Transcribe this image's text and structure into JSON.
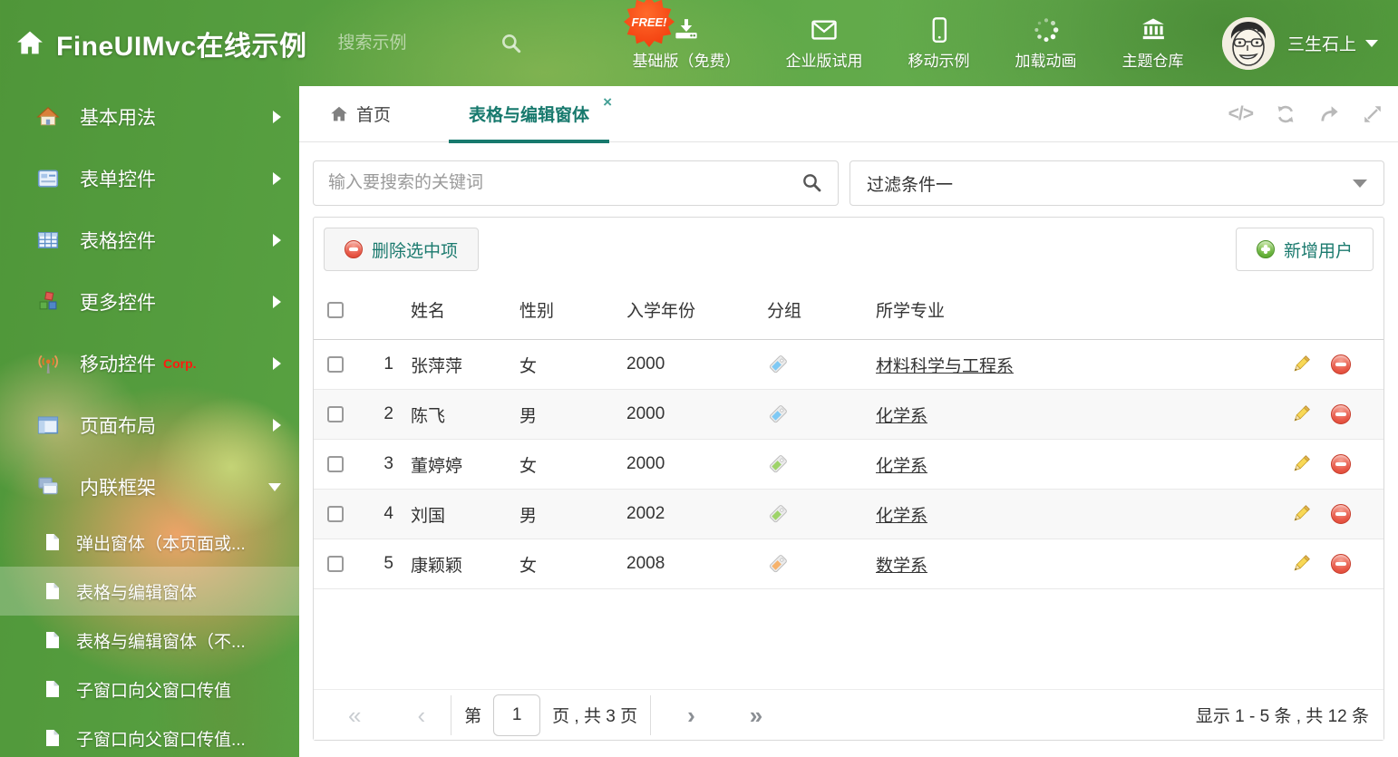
{
  "colors": {
    "accent_teal": "#17796d",
    "header_green": "#58a33e",
    "free_badge_orange": "#ff5126",
    "delete_red": "#e85948",
    "add_green": "#68b33b"
  },
  "header": {
    "title": "FineUIMvc在线示例",
    "search_placeholder": "搜索示例",
    "free_badge": "FREE!",
    "nav": [
      {
        "label": "基础版（免费）"
      },
      {
        "label": "企业版试用"
      },
      {
        "label": "移动示例"
      },
      {
        "label": "加载动画"
      },
      {
        "label": "主题仓库"
      }
    ],
    "user_name": "三生石上"
  },
  "sidebar": {
    "items": [
      {
        "label": "基本用法"
      },
      {
        "label": "表单控件"
      },
      {
        "label": "表格控件"
      },
      {
        "label": "更多控件"
      },
      {
        "label": "移动控件",
        "badge": "Corp."
      },
      {
        "label": "页面布局"
      },
      {
        "label": "内联框架"
      }
    ],
    "subitems": [
      {
        "label": "弹出窗体（本页面或..."
      },
      {
        "label": "表格与编辑窗体"
      },
      {
        "label": "表格与编辑窗体（不..."
      },
      {
        "label": "子窗口向父窗口传值"
      },
      {
        "label": "子窗口向父窗口传值..."
      }
    ]
  },
  "tabs": {
    "home_label": "首页",
    "active_label": "表格与编辑窗体"
  },
  "filter": {
    "search_placeholder": "输入要搜索的关键词",
    "dropdown_value": "过滤条件一"
  },
  "toolbar": {
    "delete_label": "删除选中项",
    "add_label": "新增用户"
  },
  "table": {
    "columns": {
      "name": "姓名",
      "gender": "性别",
      "year": "入学年份",
      "group": "分组",
      "major": "所学专业"
    },
    "rows": [
      {
        "index": "1",
        "name": "张萍萍",
        "gender": "女",
        "year": "2000",
        "tag_color": "#7fc9f4",
        "major": "材料科学与工程系"
      },
      {
        "index": "2",
        "name": "陈飞",
        "gender": "男",
        "year": "2000",
        "tag_color": "#7fc9f4",
        "major": "化学系"
      },
      {
        "index": "3",
        "name": "董婷婷",
        "gender": "女",
        "year": "2000",
        "tag_color": "#9ed36a",
        "major": "化学系"
      },
      {
        "index": "4",
        "name": "刘国",
        "gender": "男",
        "year": "2002",
        "tag_color": "#9ed36a",
        "major": "化学系"
      },
      {
        "index": "5",
        "name": "康颖颖",
        "gender": "女",
        "year": "2008",
        "tag_color": "#f6b26b",
        "major": "数学系"
      }
    ]
  },
  "pagination": {
    "page_prefix": "第",
    "page_value": "1",
    "page_suffix": "页 , 共 3 页",
    "summary": "显示 1 - 5 条 , 共 12 条"
  }
}
